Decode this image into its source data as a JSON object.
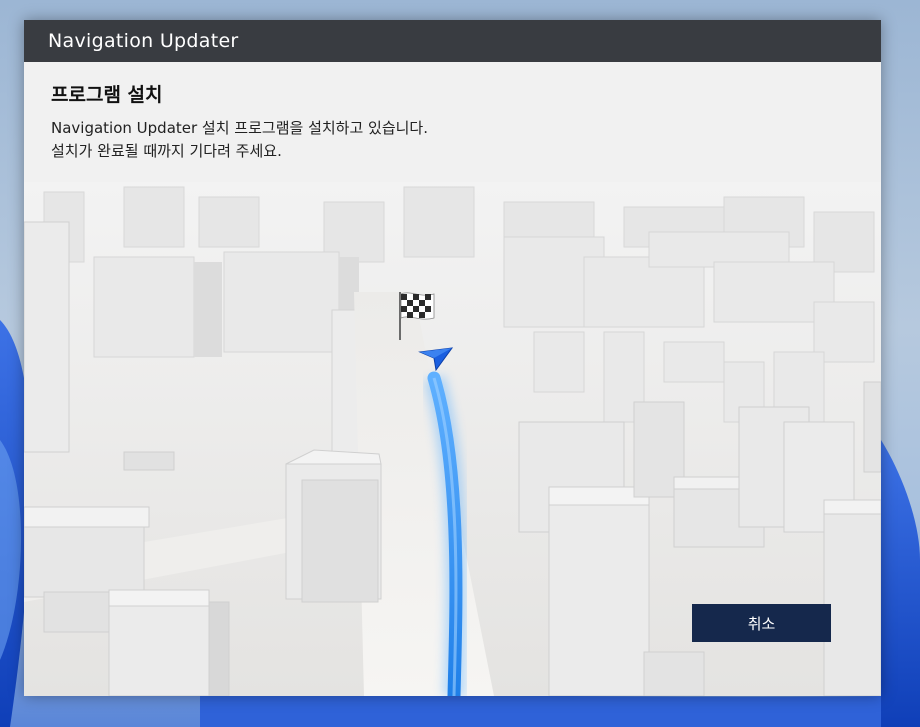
{
  "window": {
    "title": "Navigation Updater"
  },
  "header": {
    "heading": "프로그램 설치",
    "line1": "Navigation Updater 설치 프로그램을 설치하고 있습니다.",
    "line2": "설치가 완료될 때까지 기다려 주세요."
  },
  "actions": {
    "cancel_label": "취소"
  },
  "colors": {
    "titlebar": "#393c41",
    "button": "#15284c",
    "route": "#1f7fe8"
  },
  "icons": [
    "finish-flag-icon",
    "navigation-arrow-icon"
  ]
}
